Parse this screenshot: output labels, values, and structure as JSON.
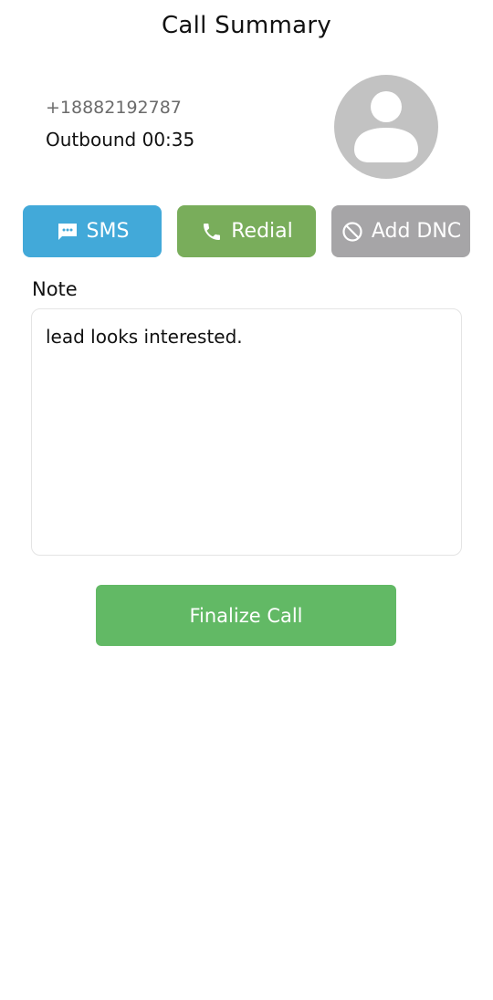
{
  "header": {
    "title": "Call Summary"
  },
  "contact": {
    "phone": "+18882192787",
    "call_info": "Outbound 00:35",
    "avatar_icon": "user-avatar-icon"
  },
  "actions": {
    "sms": {
      "label": "SMS",
      "icon": "sms-icon",
      "color": "#42a9d9"
    },
    "redial": {
      "label": "Redial",
      "icon": "phone-icon",
      "color": "#79ad5b"
    },
    "dnc": {
      "label": "Add DNC",
      "icon": "block-icon",
      "color": "#a6a5a7"
    }
  },
  "note": {
    "label": "Note",
    "value": "lead looks interested."
  },
  "finalize": {
    "label": "Finalize Call",
    "color": "#62b965"
  }
}
